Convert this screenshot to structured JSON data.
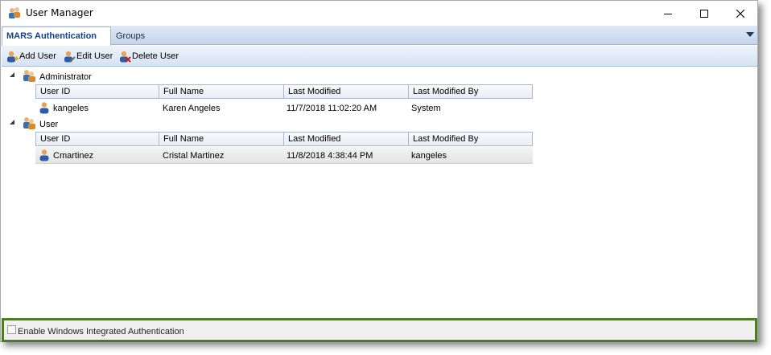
{
  "window": {
    "title": "User Manager"
  },
  "tabs": [
    {
      "label": "MARS Authentication",
      "active": true
    },
    {
      "label": "Groups",
      "active": false
    }
  ],
  "toolbar": {
    "add_label": "Add User",
    "edit_label": "Edit User",
    "delete_label": "Delete User"
  },
  "columns": [
    "User ID",
    "Full Name",
    "Last Modified",
    "Last Modified By"
  ],
  "groups": [
    {
      "name": "Administrator",
      "expanded": true,
      "rows": [
        {
          "user_id": "kangeles",
          "full_name": "Karen Angeles",
          "last_modified": "11/7/2018 11:02:20 AM",
          "last_modified_by": "System",
          "selected": false
        }
      ]
    },
    {
      "name": "User",
      "expanded": true,
      "rows": [
        {
          "user_id": "Cmartinez",
          "full_name": "Cristal Martinez",
          "last_modified": "11/8/2018 4:38:44 PM",
          "last_modified_by": "kangeles",
          "selected": true
        }
      ]
    }
  ],
  "footer": {
    "checkbox_label": "Enable Windows Integrated Authentication",
    "checked": false
  },
  "icons": {
    "app": "users-icon",
    "minimize": "minimize-icon",
    "maximize": "maximize-icon",
    "close": "close-icon",
    "add": "add-user-icon",
    "edit": "edit-user-icon",
    "delete": "delete-user-icon"
  },
  "colors": {
    "tab_bar": "#c4d5ec",
    "toolbar": "#d6e3f3",
    "footer_border": "#4f7a28"
  }
}
